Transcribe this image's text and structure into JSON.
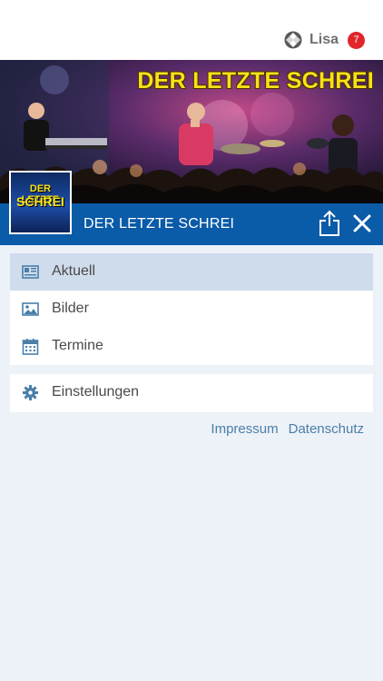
{
  "header": {
    "user_name": "Lisa",
    "notification_count": "7",
    "logo_icon": "spiral-logo-icon"
  },
  "band": {
    "banner_title": "DER LETZTE SCHREI",
    "thumb_line1": "DER LETZTE",
    "thumb_line2": "SCHREI",
    "name": "DER LETZTE SCHREI",
    "share_icon": "share-icon",
    "close_icon": "close-icon"
  },
  "menu": {
    "items": [
      {
        "label": "Aktuell",
        "icon": "newspaper-icon",
        "active": true
      },
      {
        "label": "Bilder",
        "icon": "image-icon",
        "active": false
      },
      {
        "label": "Termine",
        "icon": "calendar-icon",
        "active": false
      }
    ],
    "settings": {
      "label": "Einstellungen",
      "icon": "gear-icon"
    }
  },
  "footer": {
    "impressum": "Impressum",
    "datenschutz": "Datenschutz"
  },
  "colors": {
    "accent_bar": "#0a5ba8",
    "active_item": "#cfdcec",
    "badge": "#e0262c",
    "link": "#4a7fa8",
    "icon": "#4a7fa8"
  }
}
